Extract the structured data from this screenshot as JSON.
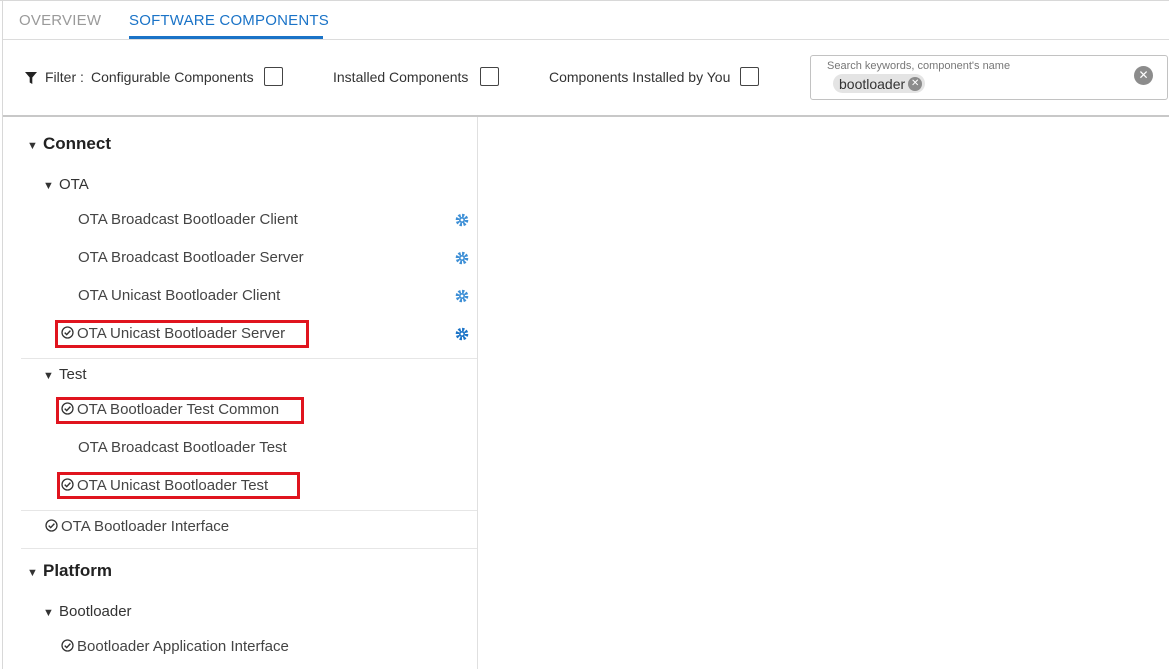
{
  "tabs": {
    "overview": "OVERVIEW",
    "software_components": "SOFTWARE COMPONENTS",
    "active": "SOFTWARE COMPONENTS"
  },
  "filter": {
    "label": "Filter :",
    "options": [
      {
        "label": "Configurable Components",
        "checked": false
      },
      {
        "label": "Installed Components",
        "checked": false
      },
      {
        "label": "Components Installed by You",
        "checked": false
      }
    ]
  },
  "search": {
    "placeholder": "Search keywords, component's name",
    "chip": "bootloader"
  },
  "tree": {
    "connect": {
      "label": "Connect",
      "ota": {
        "label": "OTA",
        "items": [
          "OTA Broadcast Bootloader Client",
          "OTA Broadcast Bootloader Server",
          "OTA Unicast Bootloader Client",
          "OTA Unicast Bootloader Server"
        ]
      },
      "test": {
        "label": "Test",
        "items": [
          "OTA Bootloader Test Common",
          "OTA Broadcast Bootloader Test",
          "OTA Unicast Bootloader Test"
        ]
      },
      "interface": "OTA Bootloader Interface"
    },
    "platform": {
      "label": "Platform",
      "bootloader": {
        "label": "Bootloader",
        "items": [
          "Bootloader Application Interface"
        ]
      }
    }
  },
  "colors": {
    "accent": "#1a73c7",
    "gear": "#3d8fd6",
    "highlight": "#e0141e"
  },
  "icons": {
    "filter": "funnel-icon",
    "installed": "check-circle-icon",
    "configure": "gear-icon",
    "clear": "close-circle-icon",
    "expand": "caret-down-icon"
  }
}
